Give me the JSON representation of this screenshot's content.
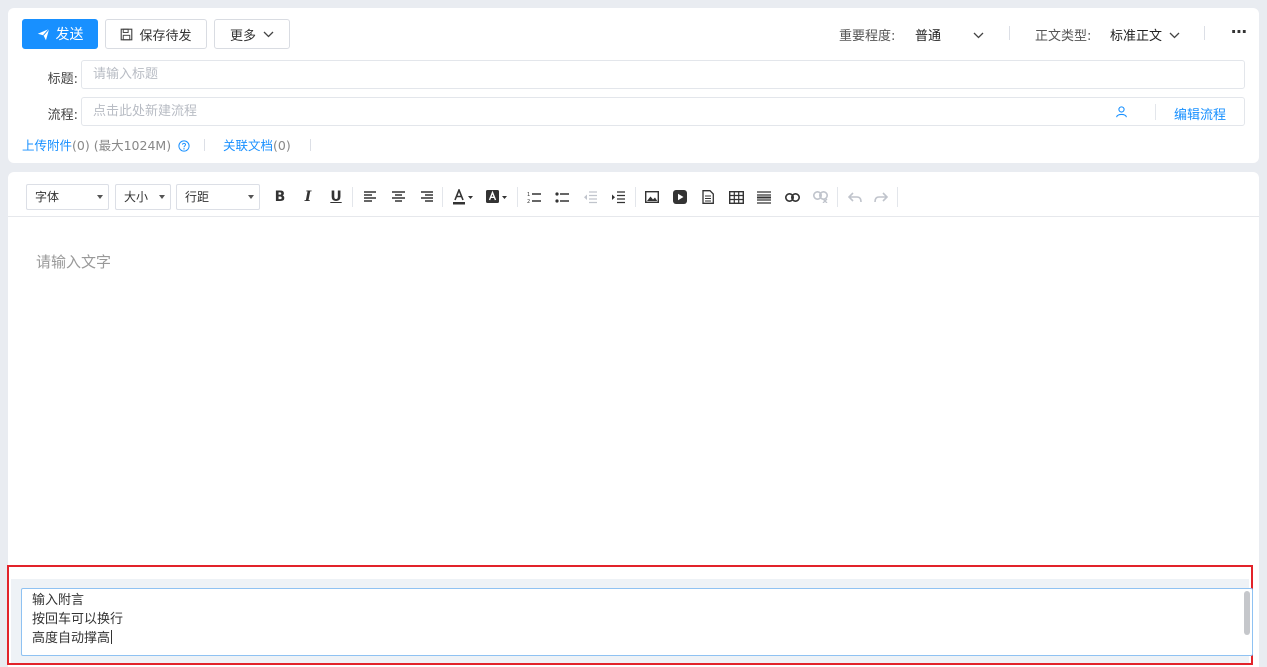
{
  "toolbar": {
    "send_label": "发送",
    "save_label": "保存待发",
    "more_label": "更多"
  },
  "options": {
    "importance_label": "重要程度:",
    "importance_value": "普通",
    "body_type_label": "正文类型:",
    "body_type_value": "标准正文",
    "more_icon": "⋯"
  },
  "form": {
    "title_label": "标题:",
    "title_placeholder": "请输入标题",
    "flow_label": "流程:",
    "flow_placeholder": "点击此处新建流程",
    "edit_flow_label": "编辑流程"
  },
  "attachments": {
    "upload_label": "上传附件",
    "upload_count": "(0)",
    "upload_limit": "(最大1024M)",
    "related_label": "关联文档",
    "related_count": "(0)"
  },
  "editor": {
    "font_label": "字体",
    "size_label": "大小",
    "line_height_label": "行距",
    "placeholder": "请输入文字"
  },
  "comment": {
    "lines": [
      "输入附言",
      "按回车可以换行",
      "高度自动撑高"
    ]
  },
  "colors": {
    "primary": "#1890ff",
    "highlight_border": "#e2232a"
  }
}
